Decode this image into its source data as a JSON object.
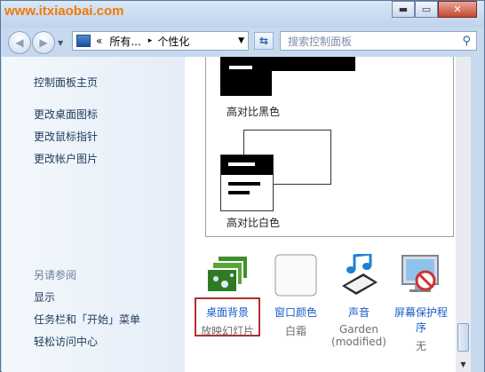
{
  "watermark": "www.itxiaobai.com",
  "window_buttons": {
    "minimize": "▬",
    "maximize": "▭",
    "close": "✕"
  },
  "address": {
    "prefix": "«",
    "crumb1": "所有...",
    "sep": "▸",
    "crumb2": "个性化",
    "drop": "▼"
  },
  "search": {
    "placeholder": "搜索控制面板"
  },
  "sidebar": {
    "home": "控制面板主页",
    "links": [
      "更改桌面图标",
      "更改鼠标指针",
      "更改帐户图片"
    ],
    "see_also_header": "另请参阅",
    "see_also": [
      "显示",
      "任务栏和「开始」菜单",
      "轻松访问中心"
    ]
  },
  "themes": [
    {
      "name": "高对比黑色"
    },
    {
      "name": "高对比白色"
    }
  ],
  "bottom_icons": [
    {
      "label": "桌面背景",
      "sub": "放映幻灯片",
      "icon": "desktop-background-icon"
    },
    {
      "label": "窗口颜色",
      "sub": "白霜",
      "icon": "window-color-icon"
    },
    {
      "label": "声音",
      "sub": "Garden (modified)",
      "icon": "sound-icon"
    },
    {
      "label": "屏幕保护程序",
      "sub": "无",
      "icon": "screensaver-icon"
    }
  ],
  "colors": {
    "accent_link": "#1d5cc6",
    "selection_border": "#b03030",
    "watermark": "#f07a00"
  }
}
